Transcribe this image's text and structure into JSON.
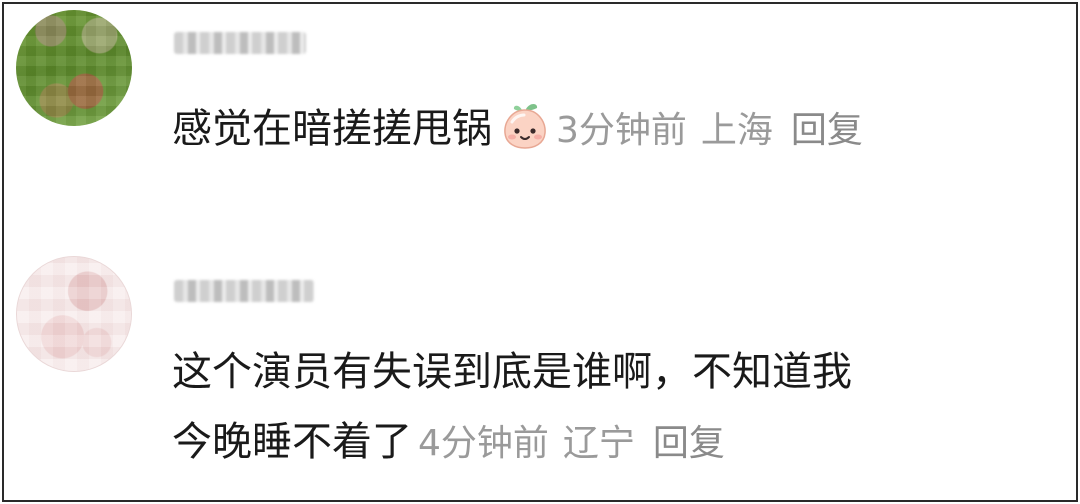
{
  "comments": [
    {
      "text": "感觉在暗搓搓甩锅",
      "emoji": "peach-smile-emoji",
      "time": "3分钟前",
      "location": "上海",
      "reply_label": "回复"
    },
    {
      "text_line1": "这个演员有失误到底是谁啊，不知道我",
      "text_line2": "今晚睡不着了",
      "time": "4分钟前",
      "location": "辽宁",
      "reply_label": "回复"
    }
  ]
}
